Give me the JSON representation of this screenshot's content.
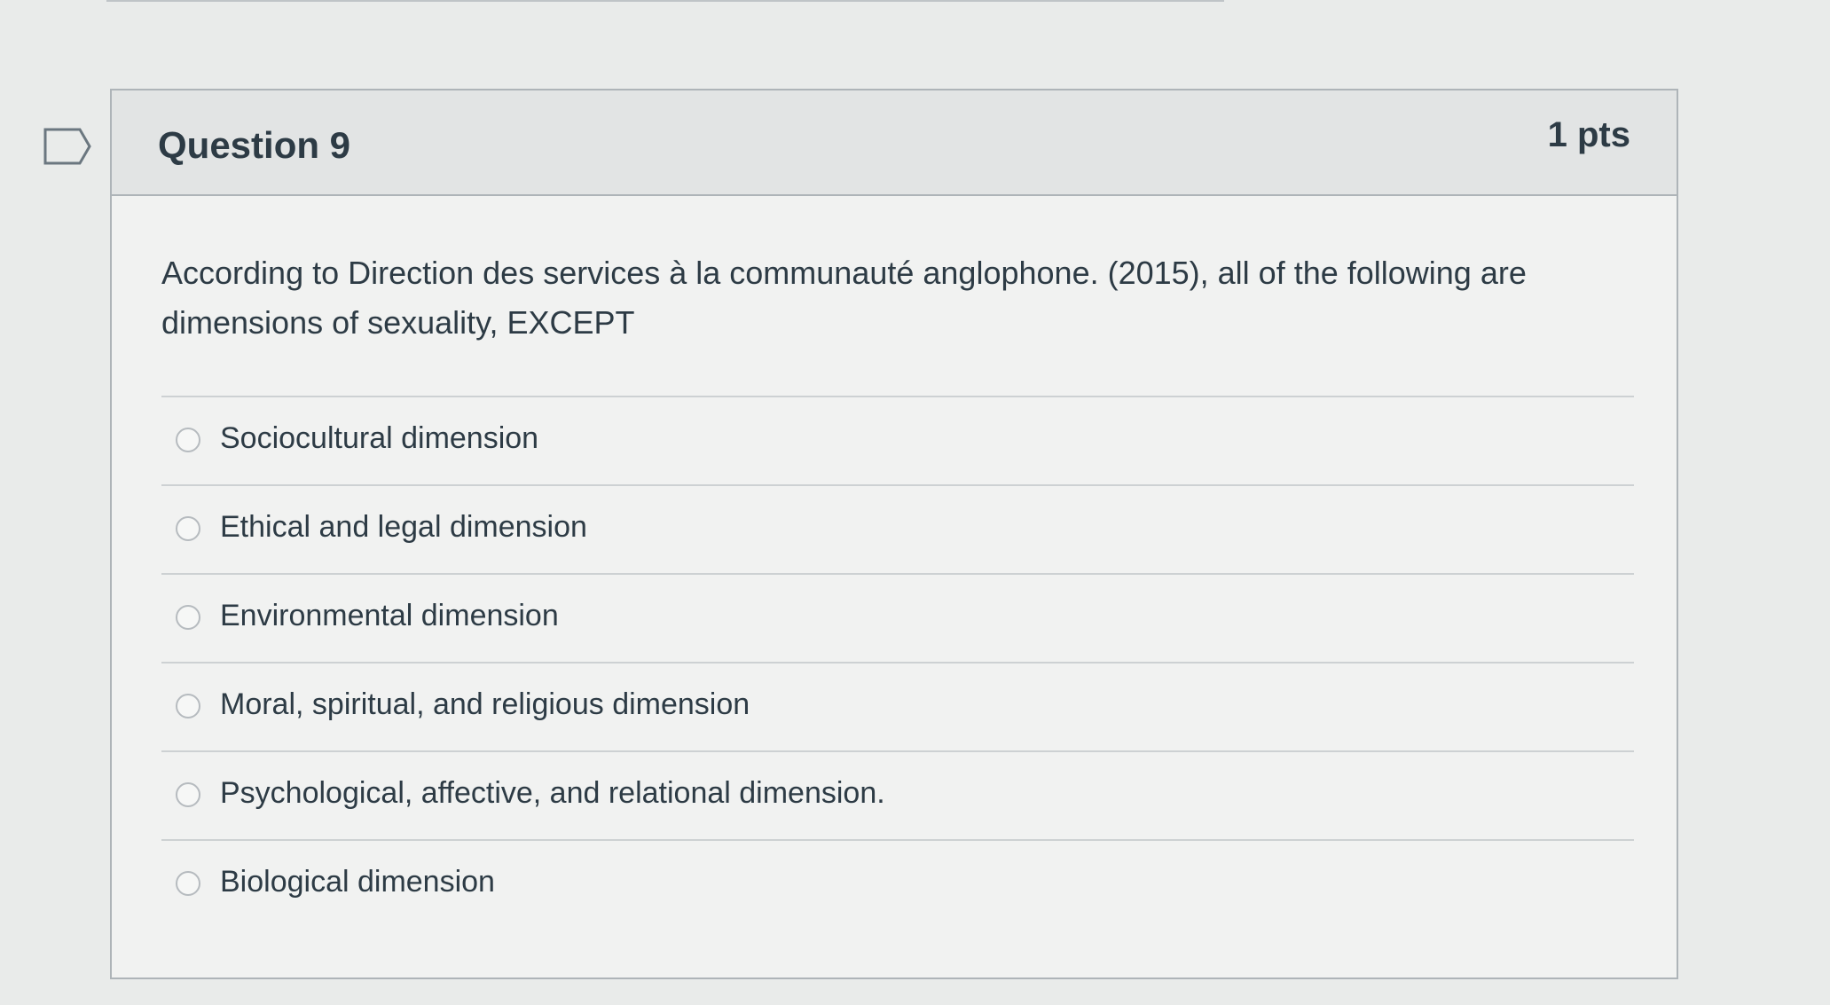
{
  "question": {
    "title": "Question 9",
    "points": "1 pts",
    "text": "According to Direction des services à la communauté anglophone. (2015), all of the following are dimensions of sexuality, EXCEPT",
    "answers": [
      {
        "label": "Sociocultural dimension"
      },
      {
        "label": "Ethical and legal dimension"
      },
      {
        "label": "Environmental dimension"
      },
      {
        "label": "Moral, spiritual, and religious dimension"
      },
      {
        "label": "Psychological, affective, and relational dimension."
      },
      {
        "label": "Biological dimension"
      }
    ]
  },
  "icons": {
    "flag": "flag-question-icon"
  },
  "colors": {
    "text": "#2d3b45",
    "border": "#aeb4b8",
    "header_bg": "#e2e4e4"
  }
}
